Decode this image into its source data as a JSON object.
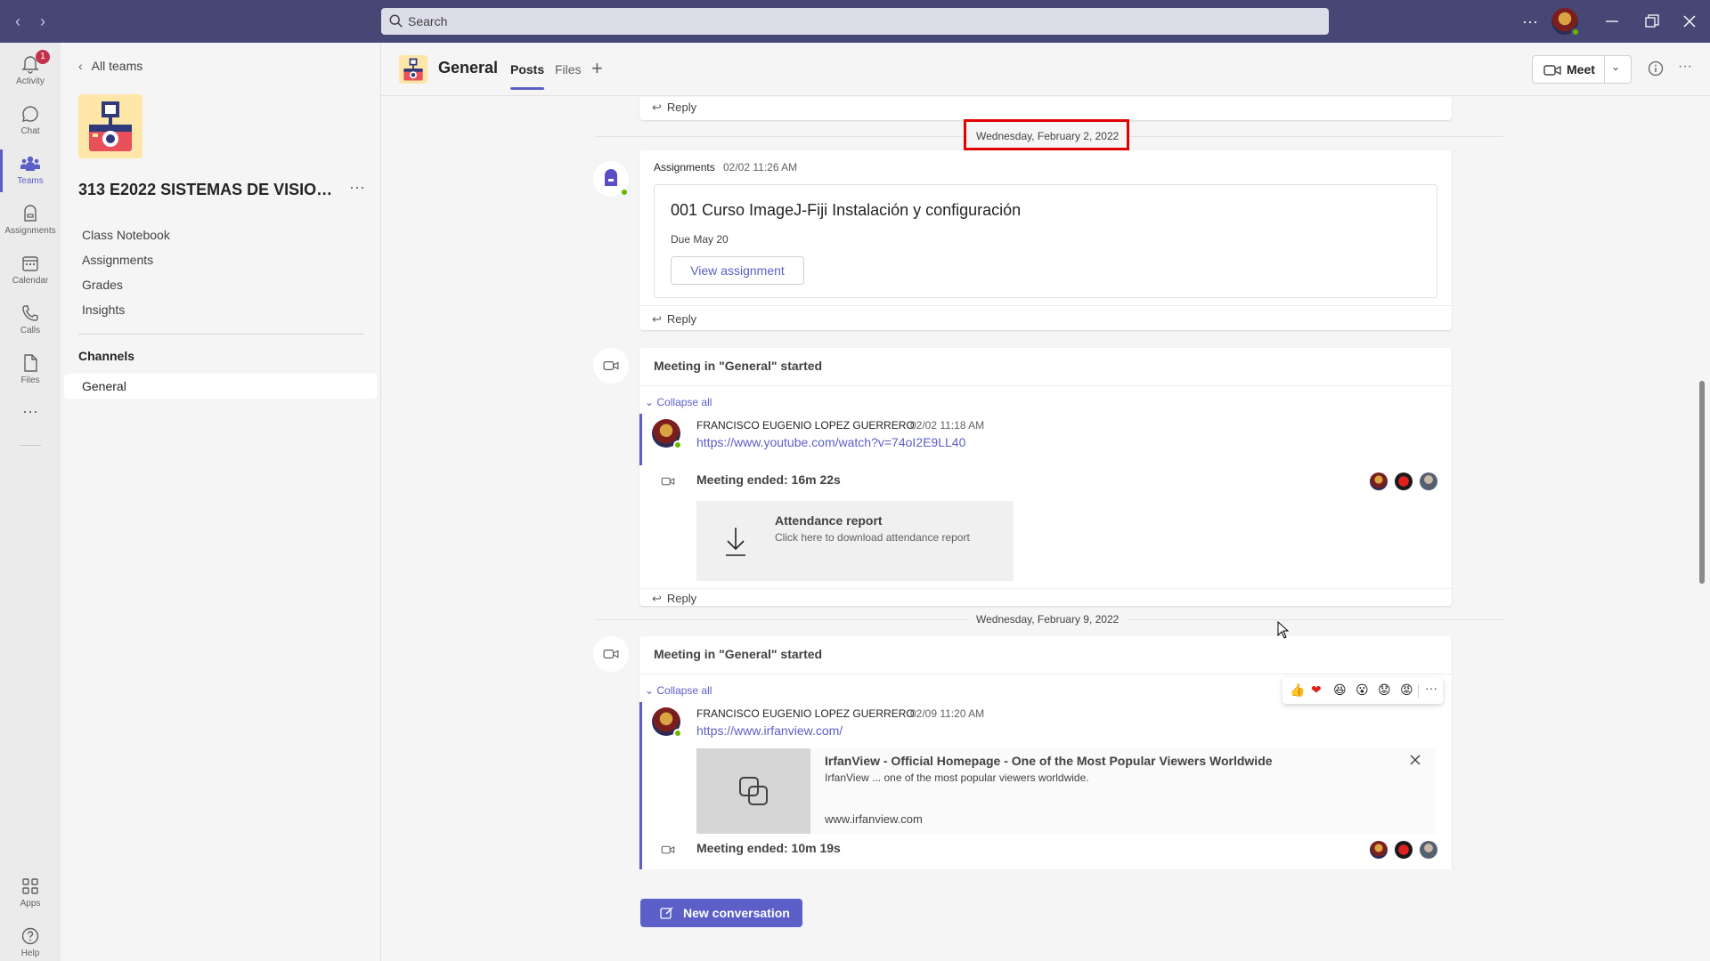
{
  "titlebar": {
    "search_placeholder": "Search",
    "more_label": "···"
  },
  "rail": {
    "items": [
      {
        "label": "Activity",
        "badge": "1"
      },
      {
        "label": "Chat"
      },
      {
        "label": "Teams"
      },
      {
        "label": "Assignments"
      },
      {
        "label": "Calendar"
      },
      {
        "label": "Calls"
      },
      {
        "label": "Files"
      },
      {
        "label": "···"
      },
      {
        "label": "Apps"
      },
      {
        "label": "Help"
      }
    ]
  },
  "sidebar": {
    "back_label": "All teams",
    "team_name": "313 E2022 SISTEMAS DE VISION ...",
    "links": [
      "Class Notebook",
      "Assignments",
      "Grades",
      "Insights"
    ],
    "channels_heading": "Channels",
    "channels": [
      "General"
    ]
  },
  "header": {
    "channel_title": "General",
    "tabs": [
      "Posts",
      "Files"
    ],
    "add_tab": "+",
    "meet_label": "Meet"
  },
  "posts": {
    "reply_label": "Reply",
    "date1": "Wednesday, February 2, 2022",
    "date2": "Wednesday, February 9, 2022",
    "assignment": {
      "author": "Assignments",
      "time": "02/02 11:26 AM",
      "title": "001 Curso ImageJ-Fiji Instalación y configuración",
      "due": "Due May 20",
      "button": "View assignment"
    },
    "meeting1": {
      "title": "Meeting in \"General\" started",
      "collapse": "Collapse all",
      "author": "FRANCISCO EUGENIO LOPEZ GUERRERO",
      "time": "02/02 11:18 AM",
      "link": "https://www.youtube.com/watch?v=74oI2E9LL40",
      "ended": "Meeting ended: 16m 22s",
      "attendance_title": "Attendance report",
      "attendance_sub": "Click here to download attendance report"
    },
    "meeting2": {
      "title": "Meeting in \"General\" started",
      "collapse": "Collapse all",
      "author": "FRANCISCO EUGENIO LOPEZ GUERRERO",
      "time": "02/09 11:20 AM",
      "link": "https://www.irfanview.com/",
      "preview_title": "IrfanView - Official Homepage - One of the Most Popular Viewers Worldwide",
      "preview_desc": "IrfanView ... one of the most popular viewers worldwide.",
      "preview_domain": "www.irfanview.com",
      "ended": "Meeting ended: 10m 19s"
    },
    "reactions": [
      "👍",
      "❤",
      "😆",
      "😮",
      "😟",
      "😡"
    ],
    "new_conversation": "New conversation"
  },
  "colors": {
    "titlebar": "#464775",
    "brand": "#5b5fc7",
    "highlight_box": "#e00000"
  }
}
